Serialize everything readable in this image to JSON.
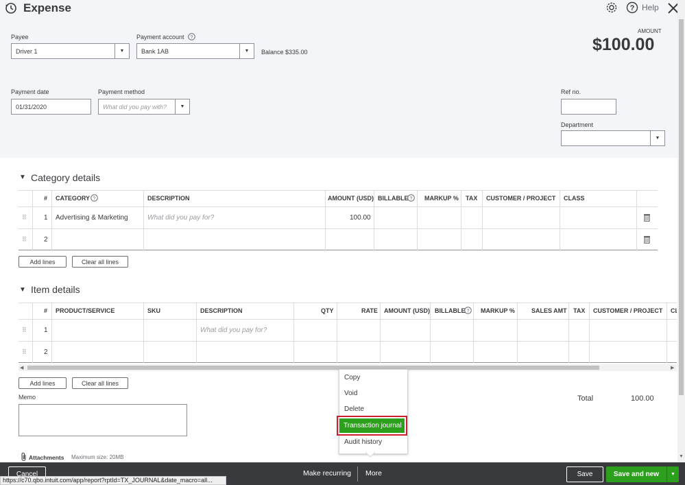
{
  "header": {
    "title": "Expense",
    "help": "Help",
    "amount_label": "AMOUNT",
    "amount": "$100.00"
  },
  "form": {
    "payee_label": "Payee",
    "payee_value": "Driver 1",
    "payment_account_label": "Payment account",
    "payment_account_value": "Bank 1AB",
    "balance": "Balance $335.00",
    "payment_date_label": "Payment date",
    "payment_date_value": "01/31/2020",
    "payment_method_label": "Payment method",
    "payment_method_placeholder": "What did you pay with?",
    "ref_label": "Ref no.",
    "ref_value": "",
    "department_label": "Department",
    "department_value": ""
  },
  "category": {
    "title": "Category details",
    "columns": [
      "#",
      "CATEGORY",
      "DESCRIPTION",
      "AMOUNT (USD)",
      "BILLABLE",
      "MARKUP %",
      "TAX",
      "CUSTOMER / PROJECT",
      "CLASS"
    ],
    "rows": [
      {
        "num": "1",
        "category": "Advertising & Marketing",
        "description": "What did you pay for?",
        "amount": "100.00"
      },
      {
        "num": "2",
        "category": "",
        "description": "",
        "amount": ""
      }
    ],
    "add_lines": "Add lines",
    "clear_all": "Clear all lines"
  },
  "items": {
    "title": "Item details",
    "columns": [
      "#",
      "PRODUCT/SERVICE",
      "SKU",
      "DESCRIPTION",
      "QTY",
      "RATE",
      "AMOUNT (USD)",
      "BILLABLE",
      "MARKUP %",
      "SALES AMT",
      "TAX",
      "CUSTOMER / PROJECT",
      "CL"
    ],
    "rows": [
      {
        "num": "1",
        "description": "What did you pay for?"
      },
      {
        "num": "2",
        "description": ""
      }
    ],
    "add_lines": "Add lines",
    "clear_all": "Clear all lines"
  },
  "memo": {
    "label": "Memo",
    "value": ""
  },
  "attachments": {
    "label": "Attachments",
    "max_size": "Maximum size: 20MB"
  },
  "total": {
    "label": "Total",
    "value": "100.00"
  },
  "more_menu": {
    "items": [
      "Copy",
      "Void",
      "Delete",
      "Transaction journal",
      "Audit history"
    ],
    "highlighted": "Transaction journal"
  },
  "footer": {
    "cancel": "Cancel",
    "make_recurring": "Make recurring",
    "more": "More",
    "save": "Save",
    "save_and_new": "Save and new"
  },
  "status_url": "https://c70.qbo.intuit.com/app/report?rptId=TX_JOURNAL&date_macro=all...",
  "colors": {
    "accent_green": "#2ca01c",
    "highlight_border": "#c9202b",
    "footer_bg": "#393a3d"
  }
}
